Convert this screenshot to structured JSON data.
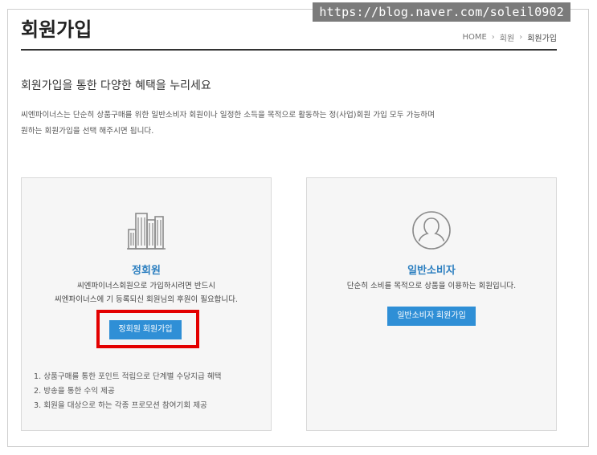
{
  "watermark": "https://blog.naver.com/soleil0902",
  "header": {
    "title": "회원가입",
    "breadcrumb": [
      "HOME",
      "회원",
      "회원가입"
    ],
    "separator": "›"
  },
  "intro": {
    "title": "회원가입을 통한 다양한 혜택을 누리세요",
    "lines": [
      "씨엔파이너스는 단순히 상품구매를 위한 일반소비자 회원이나 일정한 소득을 목적으로 활동하는 정(사업)회원 가입 모두 가능하며",
      "원하는 회원가입을 선택 해주시면 됩니다."
    ]
  },
  "cards": {
    "regular": {
      "icon": "buildings-icon",
      "title": "정회원",
      "desc": [
        "씨엔파이너스회원으로 가입하시려면 반드시",
        "씨엔파이너스에 기 등록되신 회원님의 후원이 필요합니다."
      ],
      "button": "정회원 회원가입",
      "benefits": [
        "1. 상품구매를 통한 포인트 적립으로 단계별 수당지급 혜택",
        "2. 방송을 통한 수익 제공",
        "3. 회원을 대상으로 하는 각종 프로모션 참여기회 제공"
      ]
    },
    "consumer": {
      "icon": "user-icon",
      "title": "일반소비자",
      "desc": [
        "단순히 소비를 목적으로 상품을 이용하는 회원입니다."
      ],
      "button": "일반소비자 회원가입"
    }
  },
  "colors": {
    "accent": "#2f8fd6",
    "highlight": "#e30000"
  }
}
